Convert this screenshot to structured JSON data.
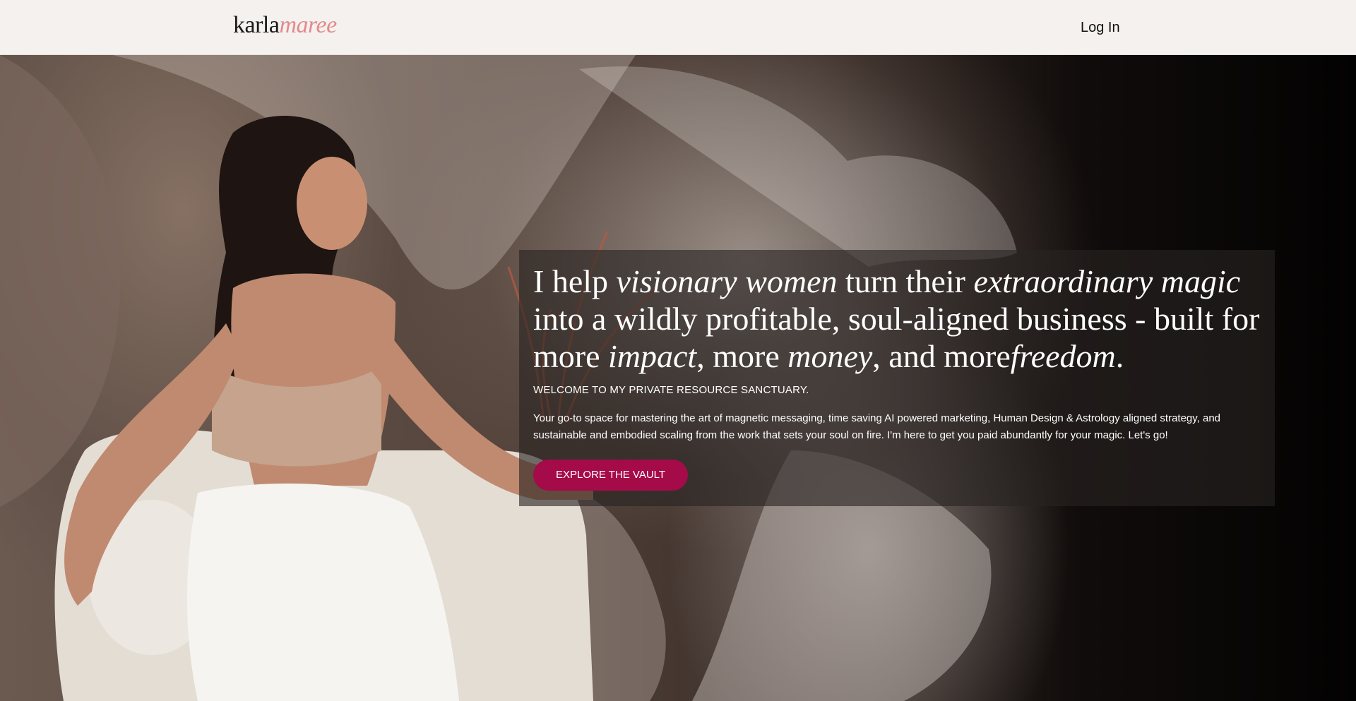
{
  "header": {
    "logo_part1": "karla",
    "logo_part2": "maree",
    "login_label": "Log In"
  },
  "hero": {
    "headline": {
      "t1": "I help ",
      "e1": "visionary women",
      "t2": " turn their ",
      "e2": "extraordinary magic",
      "t3": " into a wildly profitable, soul-aligned business - built for more ",
      "e3": "impact",
      "t4": ", more ",
      "e4": "money",
      "t5": ", and more",
      "e5": "freedom",
      "t6": "."
    },
    "welcome": "WELCOME TO MY PRIVATE RESOURCE SANCTUARY.",
    "description": "Your go-to space for mastering the art of magnetic messaging, time saving AI powered marketing, Human Design & Astrology aligned strategy, and sustainable and embodied scaling from the work that sets your soul on fire.  I'm here to get you paid abundantly for your magic. Let's go!",
    "cta_label": "EXPLORE THE VAULT"
  },
  "colors": {
    "topbar_bg": "#f4f1ee",
    "logo_accent": "#e28a8e",
    "cta_bg": "#a40b48"
  }
}
